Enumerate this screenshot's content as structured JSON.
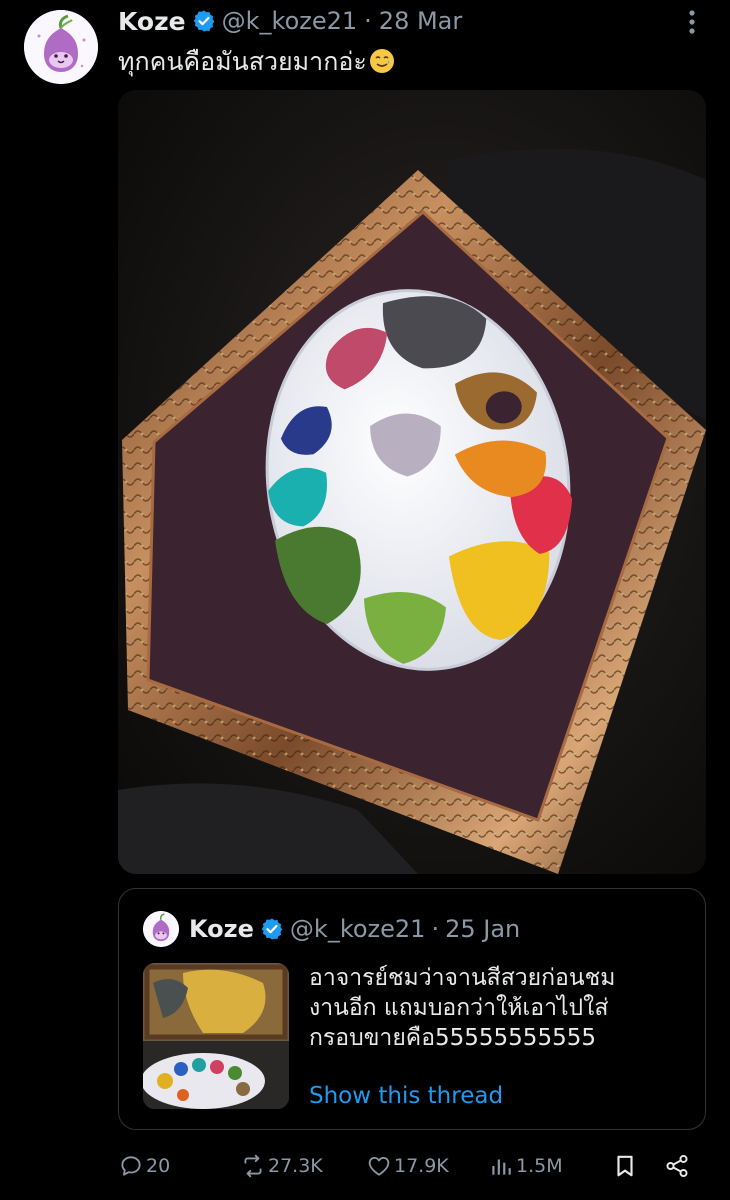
{
  "tweet": {
    "author_name": "Koze",
    "handle": "@k_koze21",
    "separator": "·",
    "date": "28 Mar",
    "text": "ทุกคนคือมันสวยมากอ่ะ",
    "emoji_icon": "smiling-face-with-tear-emoji",
    "media_description_icon": "palette-in-frame-photo"
  },
  "quote": {
    "author_name": "Koze",
    "handle": "@k_koze21",
    "separator": "·",
    "date": "25 Jan",
    "text_lines": [
      "อาจารย์ชมว่าจานสีสวยก่อนชม",
      "งานอีก แถมบอกว่าให้เอาไปใส่",
      "กรอบขายคือ55555555555"
    ],
    "link_label": "Show this thread"
  },
  "actions": {
    "replies": "20",
    "reposts": "27.3K",
    "likes": "17.9K",
    "views": "1.5M"
  },
  "colors": {
    "background": "#000000",
    "text": "#e7e9ea",
    "muted": "#8b98a5",
    "accent": "#1d9bf0",
    "border": "#2f3336"
  }
}
